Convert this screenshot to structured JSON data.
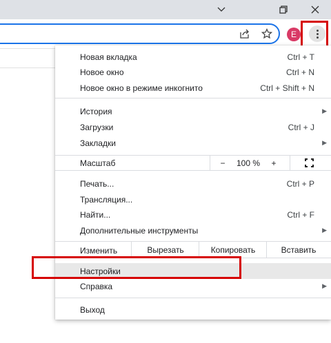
{
  "window": {
    "controls": [
      {
        "name": "chevron-down-icon"
      },
      {
        "name": "restore-icon"
      },
      {
        "name": "close-icon"
      }
    ]
  },
  "toolbar": {
    "share_icon": "share-icon",
    "bookmark_icon": "star-icon",
    "avatar_letter": "E",
    "menu_icon": "kebab-menu-icon"
  },
  "menu": {
    "new_tab": {
      "label": "Новая вкладка",
      "shortcut": "Ctrl + T"
    },
    "new_window": {
      "label": "Новое окно",
      "shortcut": "Ctrl + N"
    },
    "incognito": {
      "label": "Новое окно в режиме инкогнито",
      "shortcut": "Ctrl + Shift + N"
    },
    "history": {
      "label": "История"
    },
    "downloads": {
      "label": "Загрузки",
      "shortcut": "Ctrl + J"
    },
    "bookmarks": {
      "label": "Закладки"
    },
    "zoom": {
      "label": "Масштаб",
      "minus": "−",
      "value": "100 %",
      "plus": "+"
    },
    "print": {
      "label": "Печать...",
      "shortcut": "Ctrl + P"
    },
    "cast": {
      "label": "Трансляция..."
    },
    "find": {
      "label": "Найти...",
      "shortcut": "Ctrl + F"
    },
    "more_tools": {
      "label": "Дополнительные инструменты"
    },
    "edit": {
      "label": "Изменить",
      "cut": "Вырезать",
      "copy": "Копировать",
      "paste": "Вставить"
    },
    "settings": {
      "label": "Настройки"
    },
    "help": {
      "label": "Справка"
    },
    "exit": {
      "label": "Выход"
    }
  },
  "colors": {
    "highlight": "#d60000",
    "accent": "#1a73e8",
    "avatar": "#d93a66"
  }
}
